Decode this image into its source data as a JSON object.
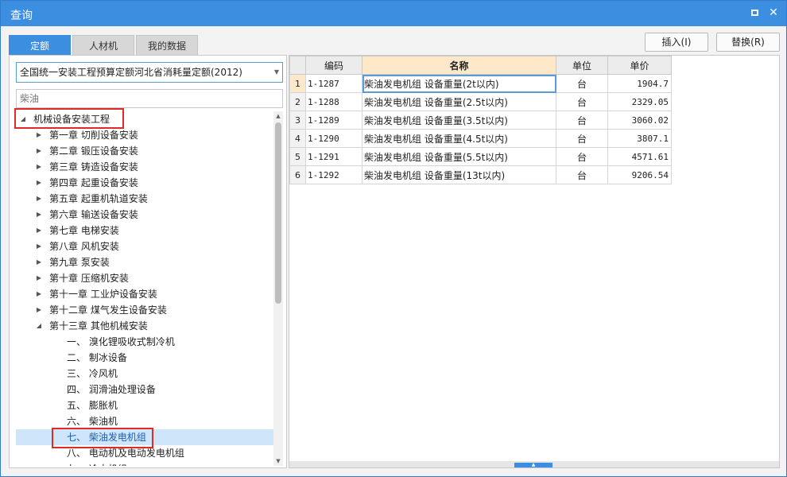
{
  "window": {
    "title": "查询"
  },
  "tabs": [
    {
      "label": "定额",
      "active": true
    },
    {
      "label": "人材机",
      "active": false
    },
    {
      "label": "我的数据",
      "active": false
    }
  ],
  "actions": {
    "insert": "插入(I)",
    "replace": "替换(R)"
  },
  "left": {
    "quota_select": "全国统一安装工程预算定额河北省消耗量定额(2012)",
    "search_placeholder": "柴油",
    "tree": [
      {
        "label": "机械设备安装工程",
        "level": 0,
        "expanded": true
      },
      {
        "label": "第一章 切削设备安装",
        "level": 1,
        "expanded": false
      },
      {
        "label": "第二章 锻压设备安装",
        "level": 1,
        "expanded": false
      },
      {
        "label": "第三章 铸造设备安装",
        "level": 1,
        "expanded": false
      },
      {
        "label": "第四章 起重设备安装",
        "level": 1,
        "expanded": false
      },
      {
        "label": "第五章 起重机轨道安装",
        "level": 1,
        "expanded": false
      },
      {
        "label": "第六章 输送设备安装",
        "level": 1,
        "expanded": false
      },
      {
        "label": "第七章 电梯安装",
        "level": 1,
        "expanded": false
      },
      {
        "label": "第八章 风机安装",
        "level": 1,
        "expanded": false
      },
      {
        "label": "第九章 泵安装",
        "level": 1,
        "expanded": false
      },
      {
        "label": "第十章 压缩机安装",
        "level": 1,
        "expanded": false
      },
      {
        "label": "第十一章 工业炉设备安装",
        "level": 1,
        "expanded": false
      },
      {
        "label": "第十二章 煤气发生设备安装",
        "level": 1,
        "expanded": false
      },
      {
        "label": "第十三章 其他机械安装",
        "level": 1,
        "expanded": true
      },
      {
        "label": "一、 溴化锂吸收式制冷机",
        "level": 2
      },
      {
        "label": "二、 制冰设备",
        "level": 2
      },
      {
        "label": "三、 冷风机",
        "level": 2
      },
      {
        "label": "四、 润滑油处理设备",
        "level": 2
      },
      {
        "label": "五、 膨胀机",
        "level": 2
      },
      {
        "label": "六、 柴油机",
        "level": 2
      },
      {
        "label": "七、 柴油发电机组",
        "level": 2,
        "selected": true
      },
      {
        "label": "八、 电动机及电动发电机组",
        "level": 2
      },
      {
        "label": "九、 冷水机组",
        "level": 2
      }
    ]
  },
  "table": {
    "headers": {
      "code": "编码",
      "name": "名称",
      "unit": "单位",
      "price": "单价"
    },
    "rows": [
      {
        "n": "1",
        "code": "1-1287",
        "name": "柴油发电机组 设备重量(2t以内)",
        "unit": "台",
        "price": "1904.7"
      },
      {
        "n": "2",
        "code": "1-1288",
        "name": "柴油发电机组 设备重量(2.5t以内)",
        "unit": "台",
        "price": "2329.05"
      },
      {
        "n": "3",
        "code": "1-1289",
        "name": "柴油发电机组 设备重量(3.5t以内)",
        "unit": "台",
        "price": "3060.02"
      },
      {
        "n": "4",
        "code": "1-1290",
        "name": "柴油发电机组 设备重量(4.5t以内)",
        "unit": "台",
        "price": "3807.1"
      },
      {
        "n": "5",
        "code": "1-1291",
        "name": "柴油发电机组 设备重量(5.5t以内)",
        "unit": "台",
        "price": "4571.61"
      },
      {
        "n": "6",
        "code": "1-1292",
        "name": "柴油发电机组 设备重量(13t以内)",
        "unit": "台",
        "price": "9206.54"
      }
    ]
  },
  "colors": {
    "accent": "#3c8ee0",
    "highlight": "#e02a2a",
    "selected_row": "#fde9c9"
  }
}
